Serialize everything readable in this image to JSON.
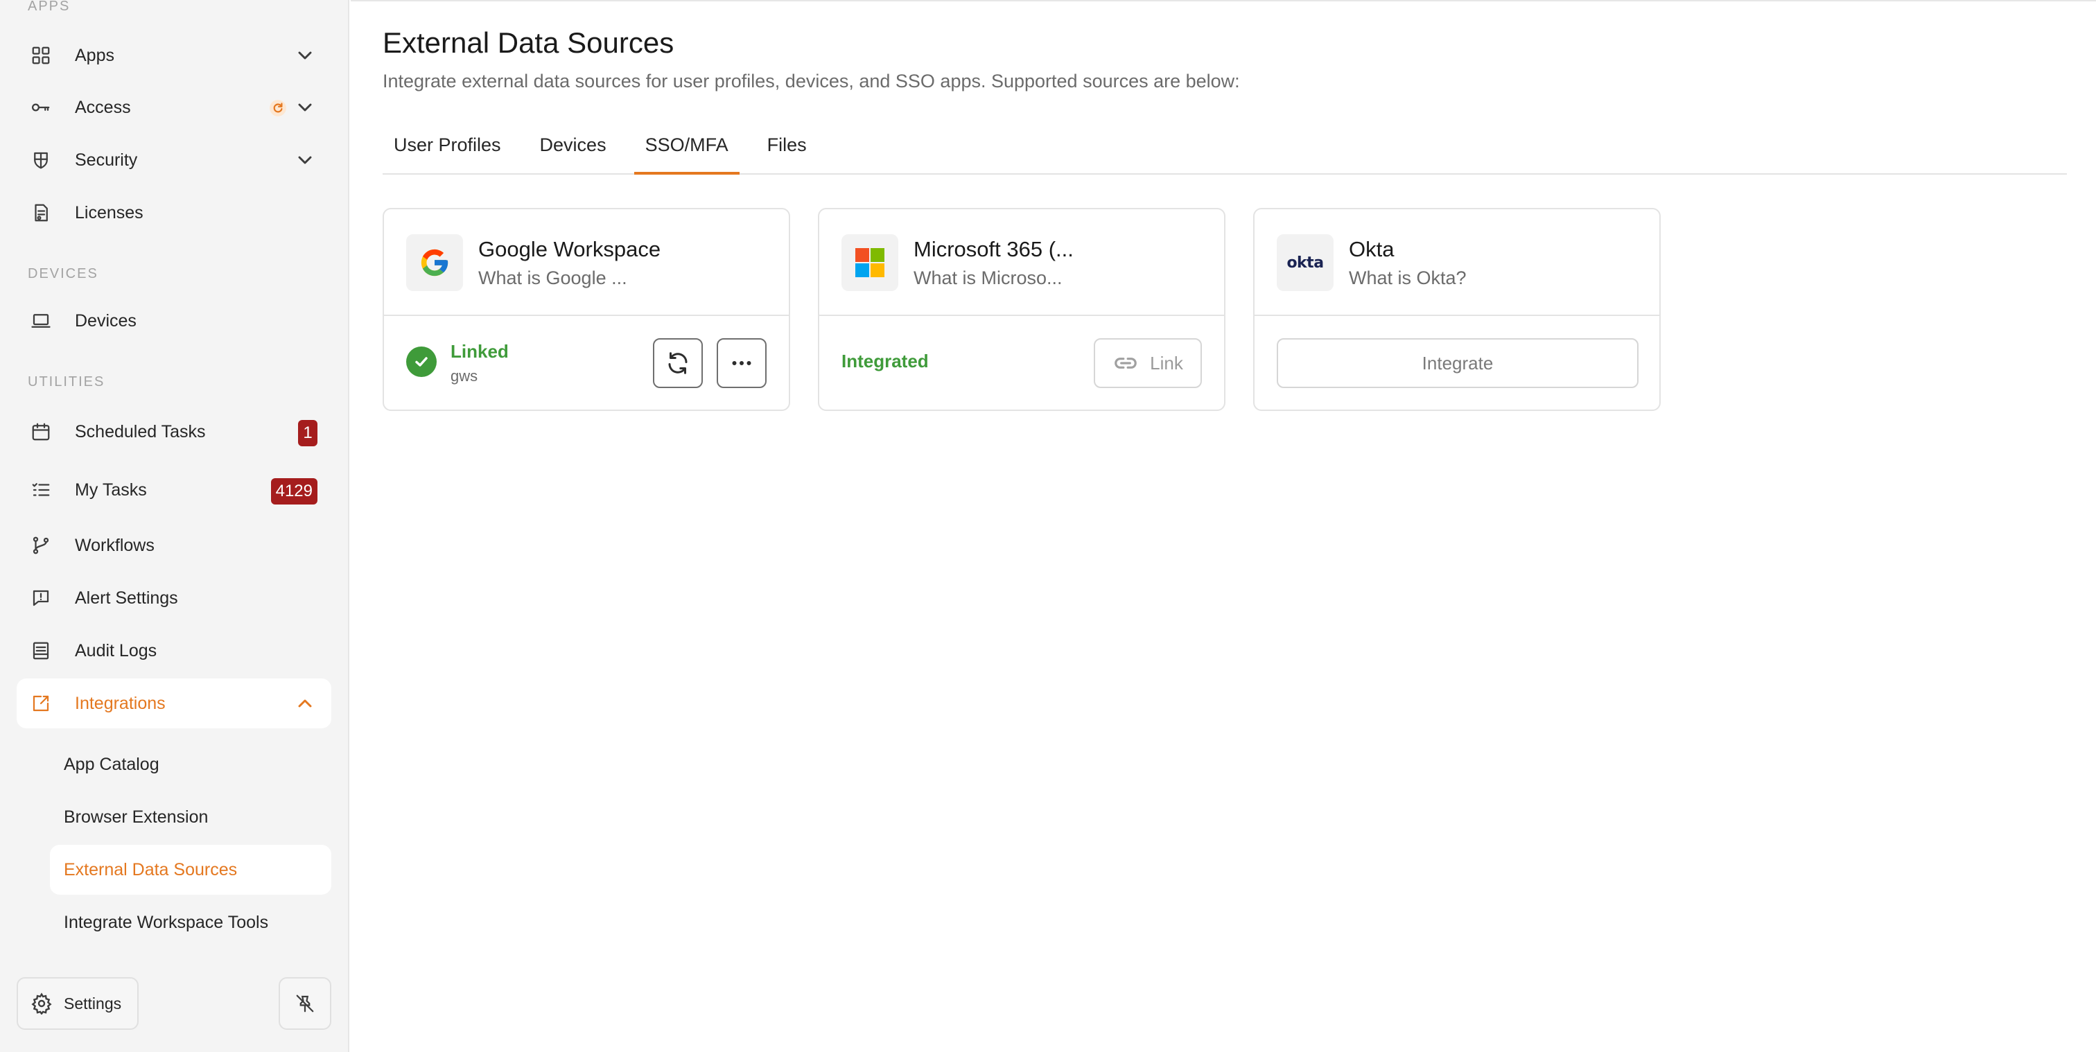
{
  "sidebar": {
    "sections": {
      "apps": "APPS",
      "devices": "DEVICES",
      "utilities": "UTILITIES"
    },
    "items": {
      "apps": "Apps",
      "access": "Access",
      "security": "Security",
      "licenses": "Licenses",
      "devices": "Devices",
      "scheduled_tasks": "Scheduled Tasks",
      "my_tasks": "My Tasks",
      "workflows": "Workflows",
      "alert_settings": "Alert Settings",
      "audit_logs": "Audit Logs",
      "integrations": "Integrations"
    },
    "badges": {
      "scheduled_tasks": "1",
      "my_tasks": "4129"
    },
    "integrations_sub": {
      "app_catalog": "App Catalog",
      "browser_extension": "Browser Extension",
      "external_data_sources": "External Data Sources",
      "integrate_workspace_tools": "Integrate Workspace Tools"
    },
    "footer": {
      "settings": "Settings"
    }
  },
  "main": {
    "title": "External Data Sources",
    "subtitle": "Integrate external data sources for user profiles, devices, and SSO apps. Supported sources are below:",
    "tabs": {
      "user_profiles": "User Profiles",
      "devices": "Devices",
      "sso_mfa": "SSO/MFA",
      "files": "Files"
    },
    "active_tab": "SSO/MFA",
    "cards": {
      "google": {
        "name": "Google Workspace",
        "desc": "What is Google ...",
        "status": "Linked",
        "status_sub": "gws"
      },
      "microsoft": {
        "name": "Microsoft 365 (...",
        "desc": "What is Microso...",
        "status": "Integrated",
        "link_label": "Link"
      },
      "okta": {
        "name": "Okta",
        "desc": "What is Okta?",
        "logo_text": "okta",
        "integrate_label": "Integrate"
      }
    }
  },
  "colors": {
    "accent": "#e47820",
    "success": "#3f9b3a",
    "badge": "#a51d1d"
  }
}
